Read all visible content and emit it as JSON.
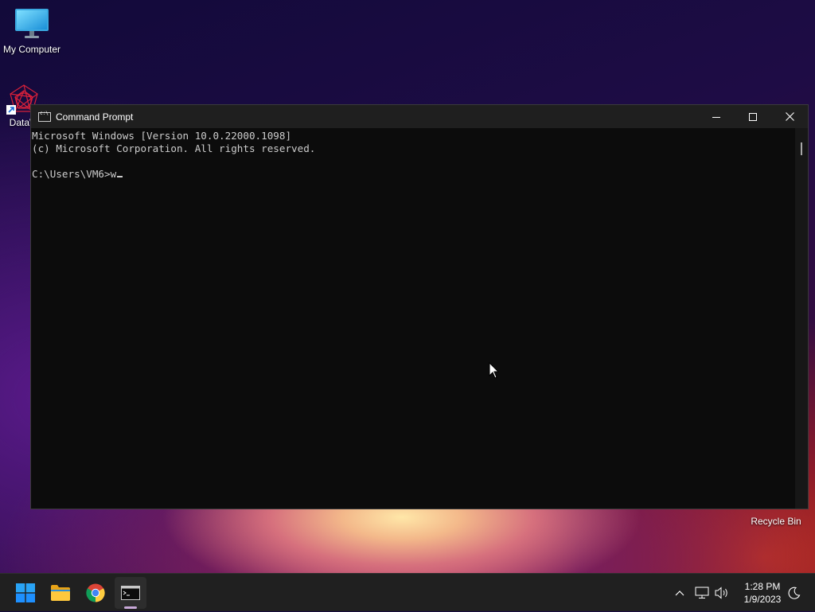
{
  "desktop": {
    "icons": [
      {
        "label": "My Computer",
        "icon": "monitor-icon"
      },
      {
        "label": "DataW",
        "icon": "datawatch-icon"
      },
      {
        "label": "Recycle Bin",
        "icon": "recycle-bin-icon"
      }
    ]
  },
  "window": {
    "title": "Command Prompt",
    "icon": "command-prompt-icon",
    "controls": {
      "minimize": "minimize-icon",
      "maximize": "maximize-icon",
      "close": "close-icon"
    },
    "console": {
      "lines": [
        "Microsoft Windows [Version 10.0.22000.1098]",
        "(c) Microsoft Corporation. All rights reserved.",
        "",
        "C:\\Users\\VM6>w"
      ]
    }
  },
  "taskbar": {
    "apps": [
      {
        "name": "Start",
        "icon": "windows-start-icon"
      },
      {
        "name": "File Explorer",
        "icon": "folder-icon"
      },
      {
        "name": "Google Chrome",
        "icon": "chrome-icon"
      },
      {
        "name": "Command Prompt",
        "icon": "command-prompt-icon",
        "active": true
      }
    ],
    "tray": {
      "time": "1:28 PM",
      "date": "1/9/2023",
      "icons": [
        "chevron-up-icon",
        "network-icon",
        "volume-icon",
        "moon-icon"
      ]
    }
  },
  "colors": {
    "console_bg": "#0c0c0c",
    "console_text": "#cccccc",
    "titlebar": "#1f1f1f",
    "taskbar": "#202020",
    "start_blue": "#1e90ff"
  }
}
